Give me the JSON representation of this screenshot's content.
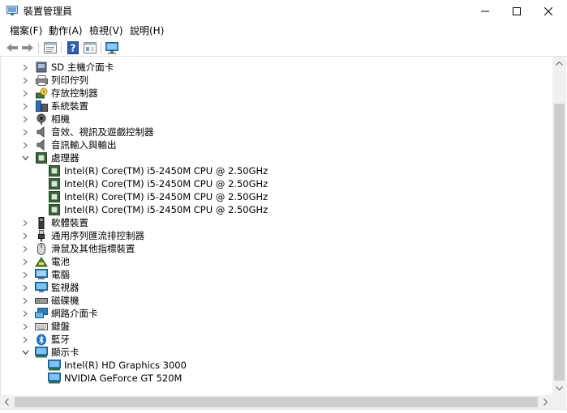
{
  "window": {
    "title": "裝置管理員",
    "icon": "device-manager-icon"
  },
  "menu": [
    {
      "label": "檔案(F)"
    },
    {
      "label": "動作(A)"
    },
    {
      "label": "檢視(V)"
    },
    {
      "label": "說明(H)"
    }
  ],
  "toolbar": {
    "icons": [
      "back-arrow-icon",
      "forward-arrow-icon",
      "properties-icon",
      "help-icon",
      "device-view-icon",
      "monitor-scan-icon"
    ]
  },
  "tree": {
    "items": [
      {
        "label": "SD 主機介面卡",
        "level": 0,
        "expanded": false,
        "icon": "sd-host-adapter-icon"
      },
      {
        "label": "列印佇列",
        "level": 0,
        "expanded": false,
        "icon": "printer-queue-icon"
      },
      {
        "label": "存放控制器",
        "level": 0,
        "expanded": false,
        "icon": "storage-controller-icon"
      },
      {
        "label": "系統裝置",
        "level": 0,
        "expanded": false,
        "icon": "system-device-icon"
      },
      {
        "label": "相機",
        "level": 0,
        "expanded": false,
        "icon": "camera-icon"
      },
      {
        "label": "音效、視訊及遊戲控制器",
        "level": 0,
        "expanded": false,
        "icon": "speaker-icon"
      },
      {
        "label": "音訊輸入與輸出",
        "level": 0,
        "expanded": false,
        "icon": "audio-io-icon"
      },
      {
        "label": "處理器",
        "level": 0,
        "expanded": true,
        "icon": "processor-icon"
      },
      {
        "label": "Intel(R) Core(TM) i5-2450M CPU @ 2.50GHz",
        "level": 1,
        "icon": "processor-icon"
      },
      {
        "label": "Intel(R) Core(TM) i5-2450M CPU @ 2.50GHz",
        "level": 1,
        "icon": "processor-icon"
      },
      {
        "label": "Intel(R) Core(TM) i5-2450M CPU @ 2.50GHz",
        "level": 1,
        "icon": "processor-icon"
      },
      {
        "label": "Intel(R) Core(TM) i5-2450M CPU @ 2.50GHz",
        "level": 1,
        "icon": "processor-icon"
      },
      {
        "label": "軟體裝置",
        "level": 0,
        "expanded": false,
        "icon": "software-device-icon"
      },
      {
        "label": "通用序列匯流排控制器",
        "level": 0,
        "expanded": false,
        "icon": "usb-controller-icon"
      },
      {
        "label": "滑鼠及其他指標裝置",
        "level": 0,
        "expanded": false,
        "icon": "mouse-icon"
      },
      {
        "label": "電池",
        "level": 0,
        "expanded": false,
        "icon": "battery-icon"
      },
      {
        "label": "電腦",
        "level": 0,
        "expanded": false,
        "icon": "computer-icon"
      },
      {
        "label": "監視器",
        "level": 0,
        "expanded": false,
        "icon": "monitor-icon"
      },
      {
        "label": "磁碟機",
        "level": 0,
        "expanded": false,
        "icon": "disk-drive-icon"
      },
      {
        "label": "網路介面卡",
        "level": 0,
        "expanded": false,
        "icon": "network-adapter-icon"
      },
      {
        "label": "鍵盤",
        "level": 0,
        "expanded": false,
        "icon": "keyboard-icon"
      },
      {
        "label": "藍牙",
        "level": 0,
        "expanded": false,
        "icon": "bluetooth-icon"
      },
      {
        "label": "顯示卡",
        "level": 0,
        "expanded": true,
        "icon": "display-adapter-icon"
      },
      {
        "label": "Intel(R) HD Graphics 3000",
        "level": 1,
        "icon": "display-adapter-icon"
      },
      {
        "label": "NVIDIA GeForce GT 520M",
        "level": 1,
        "icon": "display-adapter-icon"
      }
    ]
  },
  "colors": {
    "chip": "#3c6e3c",
    "monitor": "#2a7fc1",
    "accent_blue": "#1e73c8"
  }
}
